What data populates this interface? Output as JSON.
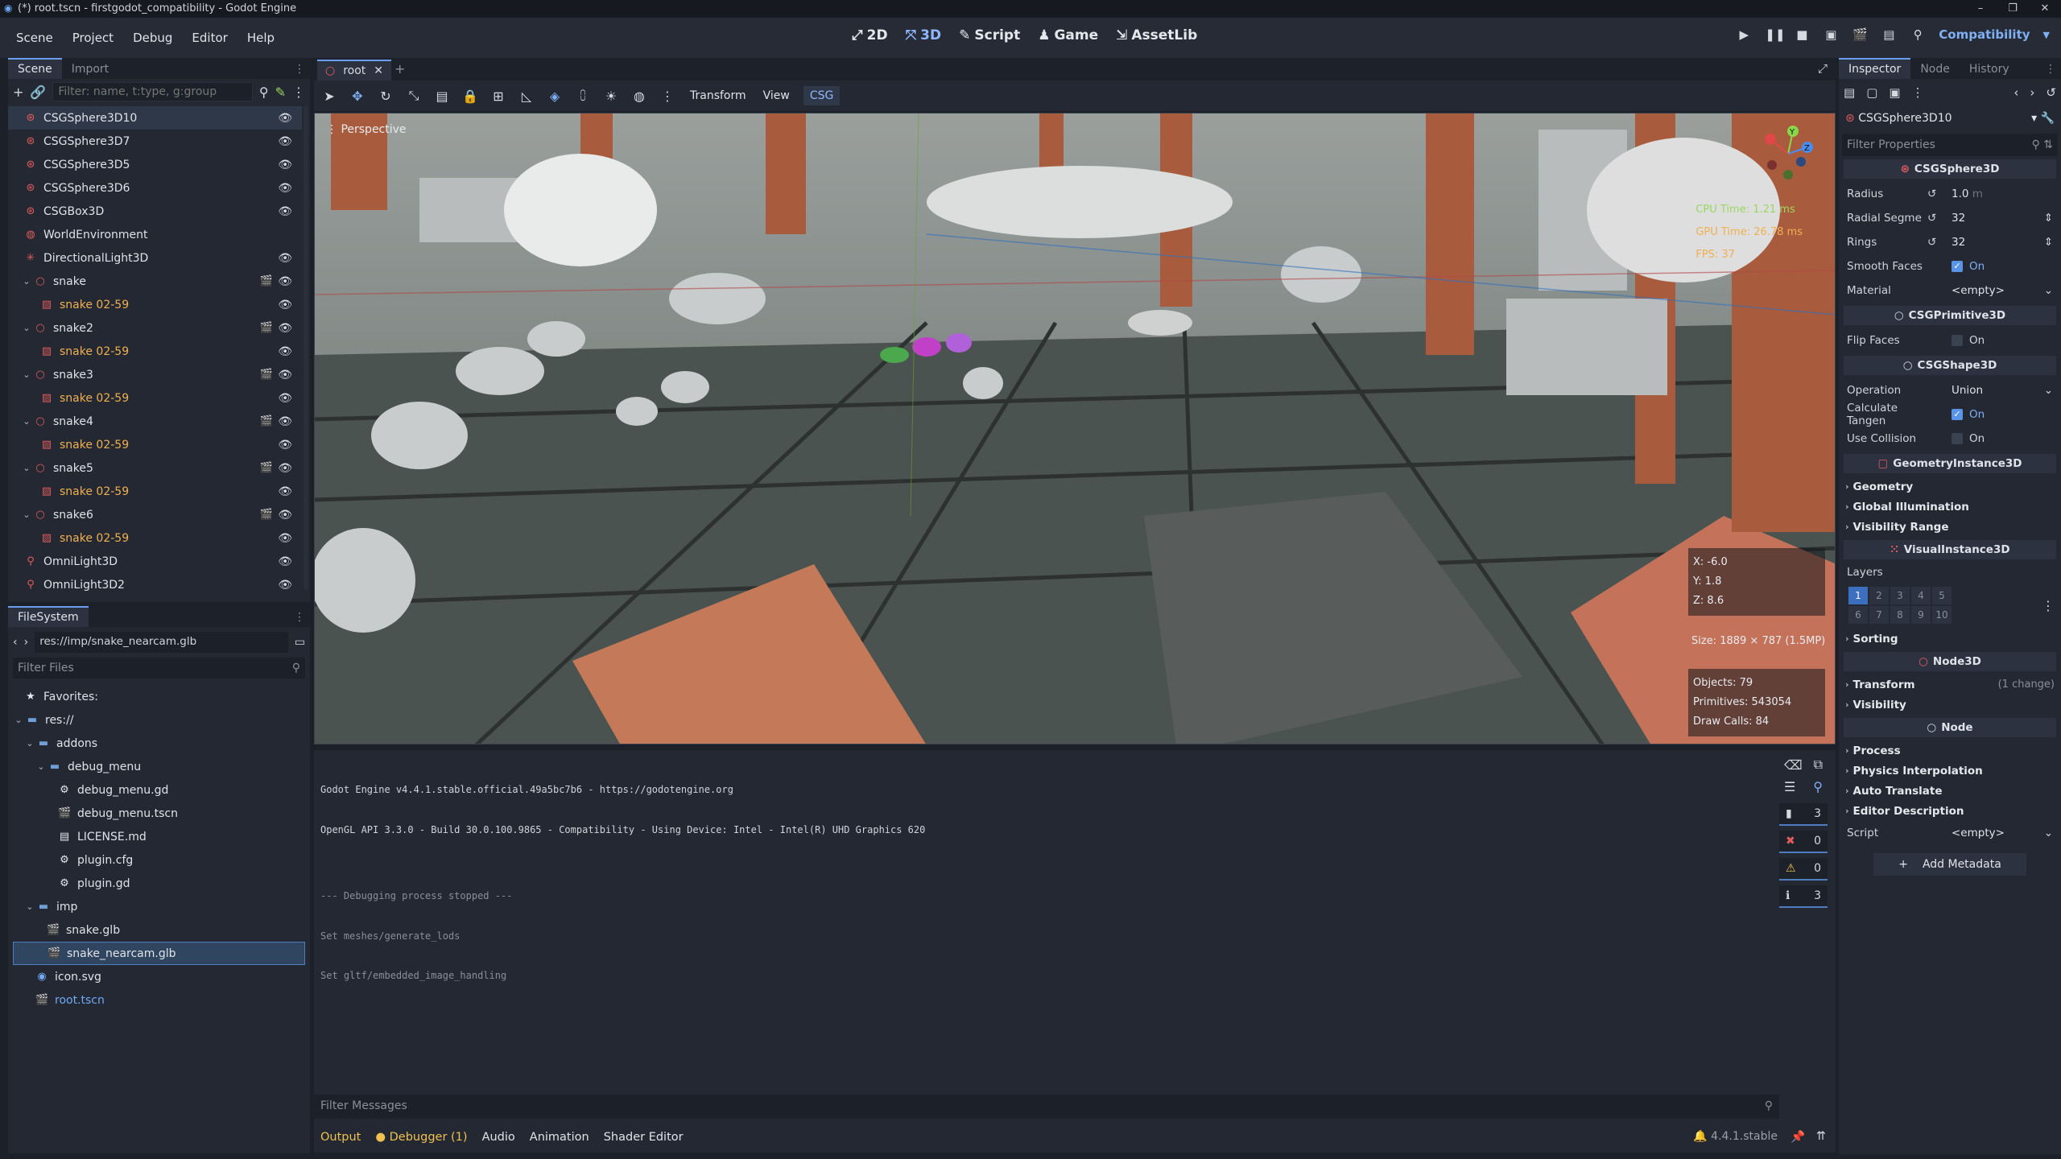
{
  "window": {
    "title": "(*) root.tscn - firstgodot_compatibility - Godot Engine",
    "controls": [
      "–",
      "❐",
      "✕"
    ]
  },
  "menu": [
    "Scene",
    "Project",
    "Debug",
    "Editor",
    "Help"
  ],
  "workspaces": [
    {
      "label": "2D",
      "icon": "2d-icon"
    },
    {
      "label": "3D",
      "icon": "3d-icon"
    },
    {
      "label": "Script",
      "icon": "script-icon"
    },
    {
      "label": "Game",
      "icon": "game-icon"
    },
    {
      "label": "AssetLib",
      "icon": "assetlib-icon"
    }
  ],
  "renderer": "Compatibility",
  "scene_dock": {
    "tabs": [
      "Scene",
      "Import"
    ],
    "filter_placeholder": "Filter: name, t:type, g:group",
    "tree": [
      {
        "label": "CSGSphere3D10",
        "type": "csg",
        "selected": true,
        "eye": true
      },
      {
        "label": "CSGSphere3D7",
        "type": "csg",
        "eye": true
      },
      {
        "label": "CSGSphere3D5",
        "type": "csg",
        "eye": true
      },
      {
        "label": "CSGSphere3D6",
        "type": "csg",
        "eye": true
      },
      {
        "label": "CSGBox3D",
        "type": "csg",
        "eye": true
      },
      {
        "label": "WorldEnvironment",
        "type": "world"
      },
      {
        "label": "DirectionalLight3D",
        "type": "light",
        "eye": true
      },
      {
        "label": "snake",
        "type": "node",
        "expand": true,
        "film": true,
        "eye": true
      },
      {
        "label": "snake 02-59",
        "type": "mesh",
        "child": true,
        "eye": true
      },
      {
        "label": "snake2",
        "type": "node",
        "expand": true,
        "film": true,
        "eye": true
      },
      {
        "label": "snake 02-59",
        "type": "mesh",
        "child": true,
        "eye": true
      },
      {
        "label": "snake3",
        "type": "node",
        "expand": true,
        "film": true,
        "eye": true
      },
      {
        "label": "snake 02-59",
        "type": "mesh",
        "child": true,
        "eye": true
      },
      {
        "label": "snake4",
        "type": "node",
        "expand": true,
        "film": true,
        "eye": true
      },
      {
        "label": "snake 02-59",
        "type": "mesh",
        "child": true,
        "eye": true
      },
      {
        "label": "snake5",
        "type": "node",
        "expand": true,
        "film": true,
        "eye": true
      },
      {
        "label": "snake 02-59",
        "type": "mesh",
        "child": true,
        "eye": true
      },
      {
        "label": "snake6",
        "type": "node",
        "expand": true,
        "film": true,
        "eye": true
      },
      {
        "label": "snake 02-59",
        "type": "mesh",
        "child": true,
        "eye": true
      },
      {
        "label": "OmniLight3D",
        "type": "omni",
        "eye": true
      },
      {
        "label": "OmniLight3D2",
        "type": "omni",
        "eye": true
      }
    ]
  },
  "filesystem": {
    "tab": "FileSystem",
    "path": "res://imp/snake_nearcam.glb",
    "filter_placeholder": "Filter Files",
    "items": [
      {
        "label": "Favorites:",
        "depth": 0,
        "icon": "star"
      },
      {
        "label": "res://",
        "depth": 0,
        "icon": "folder",
        "expand": true
      },
      {
        "label": "addons",
        "depth": 1,
        "icon": "folder",
        "expand": true
      },
      {
        "label": "debug_menu",
        "depth": 2,
        "icon": "folder",
        "expand": true
      },
      {
        "label": "debug_menu.gd",
        "depth": 3,
        "icon": "gear"
      },
      {
        "label": "debug_menu.tscn",
        "depth": 3,
        "icon": "scene"
      },
      {
        "label": "LICENSE.md",
        "depth": 3,
        "icon": "doc"
      },
      {
        "label": "plugin.cfg",
        "depth": 3,
        "icon": "gear"
      },
      {
        "label": "plugin.gd",
        "depth": 3,
        "icon": "gear"
      },
      {
        "label": "imp",
        "depth": 1,
        "icon": "folder",
        "expand": true
      },
      {
        "label": "snake.glb",
        "depth": 2,
        "icon": "scene"
      },
      {
        "label": "snake_nearcam.glb",
        "depth": 2,
        "icon": "scene",
        "selected": true
      },
      {
        "label": "icon.svg",
        "depth": 1,
        "icon": "image"
      },
      {
        "label": "root.tscn",
        "depth": 1,
        "icon": "scene",
        "blue": true
      }
    ]
  },
  "editor_tab": {
    "label": "root",
    "add": "+"
  },
  "viewport_toolbar": {
    "transform": "Transform",
    "view": "View",
    "csg": "CSG"
  },
  "viewport": {
    "label": "Perspective",
    "cpu": "CPU Time: 1.21 ms",
    "gpu": "GPU Time: 26.78 ms",
    "fps": "FPS: 37",
    "x": "X: -6.0",
    "y": "Y: 1.8",
    "z": "Z: 8.6",
    "size": "Size: 1889 × 787 (1.5MP)",
    "objects": "Objects: 79",
    "primitives": "Primitives: 543054",
    "drawcalls": "Draw Calls: 84",
    "gizmo": {
      "y": "Y",
      "z": "Z",
      "x": "X"
    }
  },
  "output": {
    "lines": [
      "Godot Engine v4.4.1.stable.official.49a5bc7b6 - https://godotengine.org",
      "OpenGL API 3.3.0 - Build 30.0.100.9865 - Compatibility - Using Device: Intel - Intel(R) UHD Graphics 620",
      "",
      "--- Debugging process stopped ---",
      "Set meshes/generate_lods",
      "Set gltf/embedded_image_handling"
    ],
    "filter_placeholder": "Filter Messages",
    "counts": [
      {
        "icon": "log-icon",
        "value": "3",
        "color": "#dfe2e8"
      },
      {
        "icon": "error-icon",
        "value": "0",
        "color": "#e25c5c"
      },
      {
        "icon": "warning-icon",
        "value": "0",
        "color": "#f0c050"
      },
      {
        "icon": "info-icon",
        "value": "3",
        "color": "#dfe2e8"
      }
    ],
    "tabs": [
      "Output",
      "Debugger (1)",
      "Audio",
      "Animation",
      "Shader Editor"
    ],
    "version": "4.4.1.stable"
  },
  "inspector": {
    "tabs": [
      "Inspector",
      "Node",
      "History"
    ],
    "node": "CSGSphere3D10",
    "filter_placeholder": "Filter Properties",
    "sections": {
      "csgsphere": "CSGSphere3D",
      "csgprim": "CSGPrimitive3D",
      "csgshape": "CSGShape3D",
      "geominst": "GeometryInstance3D",
      "visinst": "VisualInstance3D",
      "node3d": "Node3D",
      "node": "Node"
    },
    "radius": {
      "label": "Radius",
      "value": "1.0",
      "unit": "m"
    },
    "radial": {
      "label": "Radial Segme",
      "value": "32"
    },
    "rings": {
      "label": "Rings",
      "value": "32"
    },
    "smooth": {
      "label": "Smooth Faces",
      "value": "On"
    },
    "material": {
      "label": "Material",
      "value": "<empty>"
    },
    "flip": {
      "label": "Flip Faces",
      "value": "On"
    },
    "operation": {
      "label": "Operation",
      "value": "Union"
    },
    "tangent": {
      "label": "Calculate Tangen",
      "value": "On"
    },
    "collision": {
      "label": "Use Collision",
      "value": "On"
    },
    "groups_geo": [
      "Geometry",
      "Global Illumination",
      "Visibility Range"
    ],
    "layers_label": "Layers",
    "layers": [
      "1",
      "2",
      "3",
      "4",
      "5",
      "6",
      "7",
      "8",
      "9",
      "10"
    ],
    "sorting": "Sorting",
    "transform": {
      "label": "Transform",
      "note": "(1 change)"
    },
    "visibility": "Visibility",
    "groups_node": [
      "Process",
      "Physics Interpolation",
      "Auto Translate",
      "Editor Description"
    ],
    "script": {
      "label": "Script",
      "value": "<empty>"
    },
    "add_metadata": "Add Metadata"
  }
}
